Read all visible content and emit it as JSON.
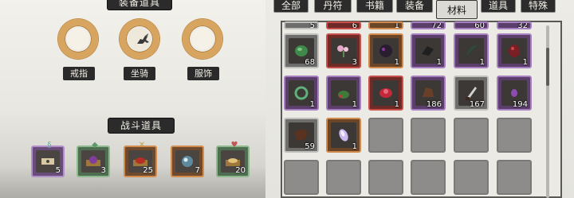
{
  "left": {
    "equip_title": "装备道具",
    "battle_title": "战斗道具",
    "equip_slots": [
      {
        "label": "戒指",
        "filled": false
      },
      {
        "label": "坐骑",
        "filled": true
      },
      {
        "label": "服饰",
        "filled": false
      }
    ],
    "battle_items": [
      {
        "count": "5",
        "badge": "§"
      },
      {
        "count": "3",
        "badge": "◆"
      },
      {
        "count": "25",
        "badge": "✕"
      },
      {
        "count": "7",
        "badge": ""
      },
      {
        "count": "20",
        "badge": "♥"
      }
    ],
    "bottom_text": "…"
  },
  "tabs": [
    "全部",
    "丹符",
    "书籍",
    "装备",
    "材料",
    "道具",
    "特殊"
  ],
  "active_tab": "材料",
  "inventory": {
    "top_partial_counts": [
      "5",
      "6",
      "1",
      "72",
      "60",
      "32"
    ],
    "rows": [
      [
        {
          "rarity": "gray",
          "count": "68",
          "icon": "green-leaf-icon"
        },
        {
          "rarity": "red",
          "count": "3",
          "icon": "pink-flower-icon"
        },
        {
          "rarity": "orange",
          "count": "1",
          "icon": "dark-beast-icon"
        },
        {
          "rarity": "purple",
          "count": "1",
          "icon": "black-claw-icon"
        },
        {
          "rarity": "purple",
          "count": "1",
          "icon": "feather-icon"
        },
        {
          "rarity": "purple",
          "count": "1",
          "icon": "red-heart-icon"
        }
      ],
      [
        {
          "rarity": "purple",
          "count": "1",
          "icon": "jade-ring-icon"
        },
        {
          "rarity": "purple",
          "count": "1",
          "icon": "herb-pot-icon"
        },
        {
          "rarity": "red",
          "count": "1",
          "icon": "red-lotus-icon"
        },
        {
          "rarity": "purple",
          "count": "186",
          "icon": "wood-chip-icon"
        },
        {
          "rarity": "gray",
          "count": "167",
          "icon": "blade-shard-icon"
        },
        {
          "rarity": "purple",
          "count": "194",
          "icon": "purple-gem-icon"
        }
      ],
      [
        {
          "rarity": "gray",
          "count": "59",
          "icon": "brown-hide-icon"
        },
        {
          "rarity": "orange",
          "count": "1",
          "icon": "crystal-shard-icon"
        },
        {
          "rarity": "empty",
          "count": "",
          "icon": ""
        },
        {
          "rarity": "empty",
          "count": "",
          "icon": ""
        },
        {
          "rarity": "empty",
          "count": "",
          "icon": ""
        },
        {
          "rarity": "empty",
          "count": "",
          "icon": ""
        }
      ],
      [
        {
          "rarity": "empty",
          "count": "",
          "icon": ""
        },
        {
          "rarity": "empty",
          "count": "",
          "icon": ""
        },
        {
          "rarity": "empty",
          "count": "",
          "icon": ""
        },
        {
          "rarity": "empty",
          "count": "",
          "icon": ""
        },
        {
          "rarity": "empty",
          "count": "",
          "icon": ""
        },
        {
          "rarity": "empty",
          "count": "",
          "icon": ""
        }
      ]
    ]
  }
}
